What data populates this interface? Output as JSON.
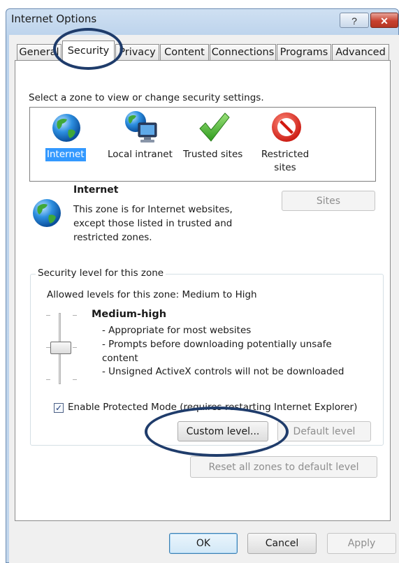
{
  "window": {
    "title": "Internet Options",
    "help_label": "?",
    "close_label": "✕"
  },
  "tabs": [
    "General",
    "Security",
    "Privacy",
    "Content",
    "Connections",
    "Programs",
    "Advanced"
  ],
  "security": {
    "zone_prompt": "Select a zone to view or change security settings.",
    "zones": [
      {
        "label_lines": [
          "Internet"
        ],
        "icon": "globe-icon",
        "selected": true
      },
      {
        "label_lines": [
          "Local intranet"
        ],
        "icon": "intranet-icon",
        "selected": false
      },
      {
        "label_lines": [
          "Trusted sites"
        ],
        "icon": "check-icon",
        "selected": false
      },
      {
        "label_lines": [
          "Restricted",
          "sites"
        ],
        "icon": "restricted-icon",
        "selected": false
      }
    ],
    "zone_info": {
      "title": "Internet",
      "description_lines": [
        "This zone is for Internet websites,",
        "except those listed in trusted and",
        "restricted zones."
      ],
      "sites_button": "Sites"
    },
    "level_group": {
      "legend": "Security level for this zone",
      "allowed": "Allowed levels for this zone: Medium to High",
      "level_name": "Medium-high",
      "bullets": [
        "- Appropriate for most websites",
        "- Prompts before downloading potentially unsafe",
        "content",
        "- Unsigned ActiveX controls will not be downloaded"
      ],
      "protected_mode_label": "Enable Protected Mode (requires restarting Internet Explorer)",
      "protected_mode_checked": true,
      "custom_level_button": "Custom level...",
      "default_level_button": "Default level"
    },
    "reset_button": "Reset all zones to default level"
  },
  "footer": {
    "ok": "OK",
    "cancel": "Cancel",
    "apply": "Apply"
  }
}
